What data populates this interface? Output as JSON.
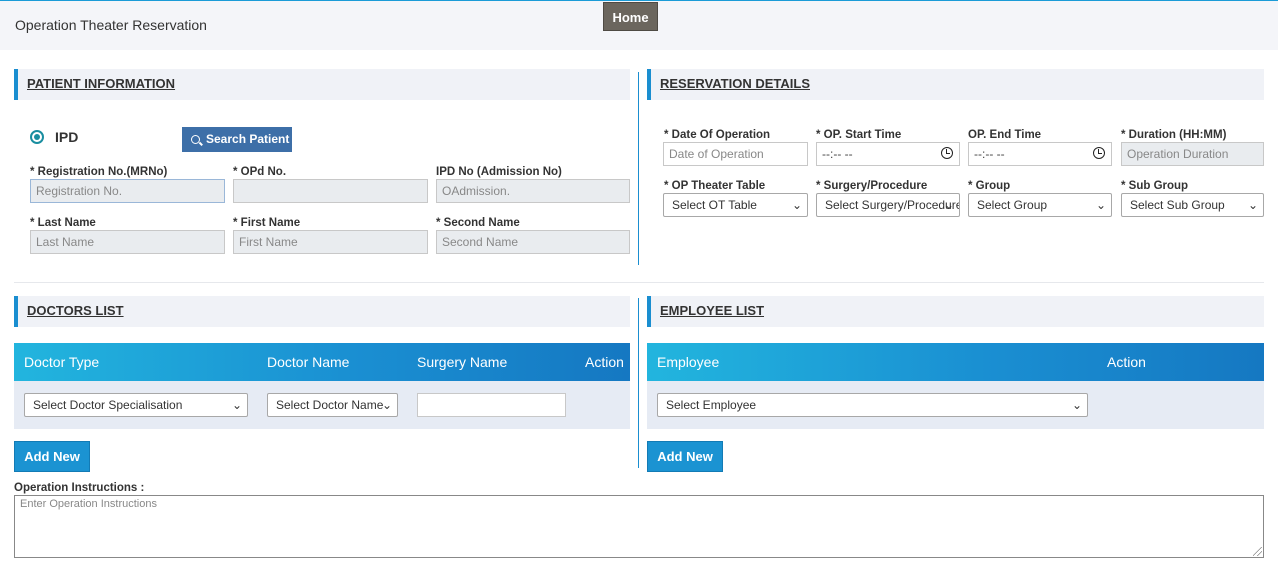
{
  "header": {
    "title": "Operation Theater Reservation",
    "home_label": "Home"
  },
  "patient": {
    "section_title": "PATIENT INFORMATION",
    "radio_label": "IPD",
    "search_label": "Search Patient",
    "reg_label": "* Registration No.(MRNo)",
    "reg_placeholder": "Registration No.",
    "opd_label": "* OPd No.",
    "opd_placeholder": "",
    "ipd_label": "IPD No (Admission No)",
    "ipd_placeholder": "OAdmission.",
    "last_label": "* Last Name",
    "last_placeholder": "Last Name",
    "first_label": "* First Name",
    "first_placeholder": "First Name",
    "second_label": "* Second Name",
    "second_placeholder": "Second Name"
  },
  "reservation": {
    "section_title": "RESERVATION DETAILS",
    "date_label": "* Date Of Operation",
    "date_placeholder": "Date of Operation",
    "start_label": "* OP. Start Time",
    "start_value": "--:-- --",
    "end_label": "OP. End Time",
    "end_value": "--:-- --",
    "duration_label": "* Duration (HH:MM)",
    "duration_placeholder": "Operation Duration",
    "ot_label": "* OP Theater Table",
    "ot_value": "Select OT Table",
    "surgery_label": "* Surgery/Procedure",
    "surgery_value": "Select Surgery/Procedure",
    "group_label": "* Group",
    "group_value": "Select Group",
    "subgroup_label": "* Sub Group",
    "subgroup_value": "Select Sub Group"
  },
  "doctors": {
    "section_title": "DOCTORS LIST",
    "columns": [
      "Doctor Type",
      "Doctor Name",
      "Surgery Name",
      "Action"
    ],
    "type_value": "Select Doctor Specialisation",
    "name_value": "Select Doctor Name",
    "add_label": "Add New"
  },
  "employees": {
    "section_title": "EMPLOYEE LIST",
    "columns": [
      "Employee",
      "Action"
    ],
    "employee_value": "Select Employee",
    "add_label": "Add New"
  },
  "instructions": {
    "label": "Operation Instructions :",
    "placeholder": "Enter Operation Instructions"
  },
  "colors": {
    "accent": "#1a8ed0",
    "button": "#1b93d2",
    "home": "#6b665e"
  }
}
